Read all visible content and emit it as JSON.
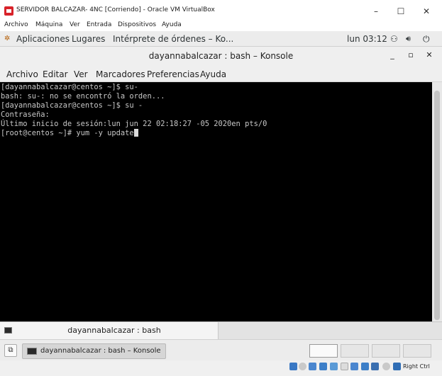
{
  "vbox": {
    "title": "SERVIDOR BALCAZAR- 4NC [Corriendo] - Oracle VM VirtualBox",
    "window_controls": {
      "minimize": "–",
      "maximize": "☐",
      "close": "✕"
    },
    "menu": [
      "Archivo",
      "Máquina",
      "Ver",
      "Entrada",
      "Dispositivos",
      "Ayuda"
    ],
    "status": {
      "host_key": "Right Ctrl"
    }
  },
  "gnome": {
    "applications": "Aplicaciones",
    "places": "Lugares",
    "active_window": "Intérprete de órdenes – Ko...",
    "clock": "lun 03:12",
    "network_icon": "⚇",
    "volume_icon": "🔊︎",
    "power_icon": "⏻"
  },
  "konsole": {
    "title": "dayannabalcazar : bash – Konsole",
    "controls": {
      "minimize": "_",
      "maximize": "▫",
      "close": "✕"
    },
    "menu": [
      "Archivo",
      "Editar",
      "Ver",
      "Marcadores",
      "Preferencias",
      "Ayuda"
    ],
    "terminal_lines": [
      "[dayannabalcazar@centos ~]$ su-",
      "bash: su-: no se encontró la orden...",
      "[dayannabalcazar@centos ~]$ su -",
      "Contraseña:",
      "Último inicio de sesión:lun jun 22 02:18:27 -05 2020en pts/0",
      "[root@centos ~]# yum -y update"
    ],
    "tab_label": "dayannabalcazar : bash"
  },
  "taskbar": {
    "show_desktop_icon": "⧉",
    "task_label": "dayannabalcazar : bash – Konsole"
  },
  "colors": {
    "terminal_bg": "#000000",
    "terminal_fg": "#c8c8c8",
    "vbox_icon": "#d8232a"
  }
}
